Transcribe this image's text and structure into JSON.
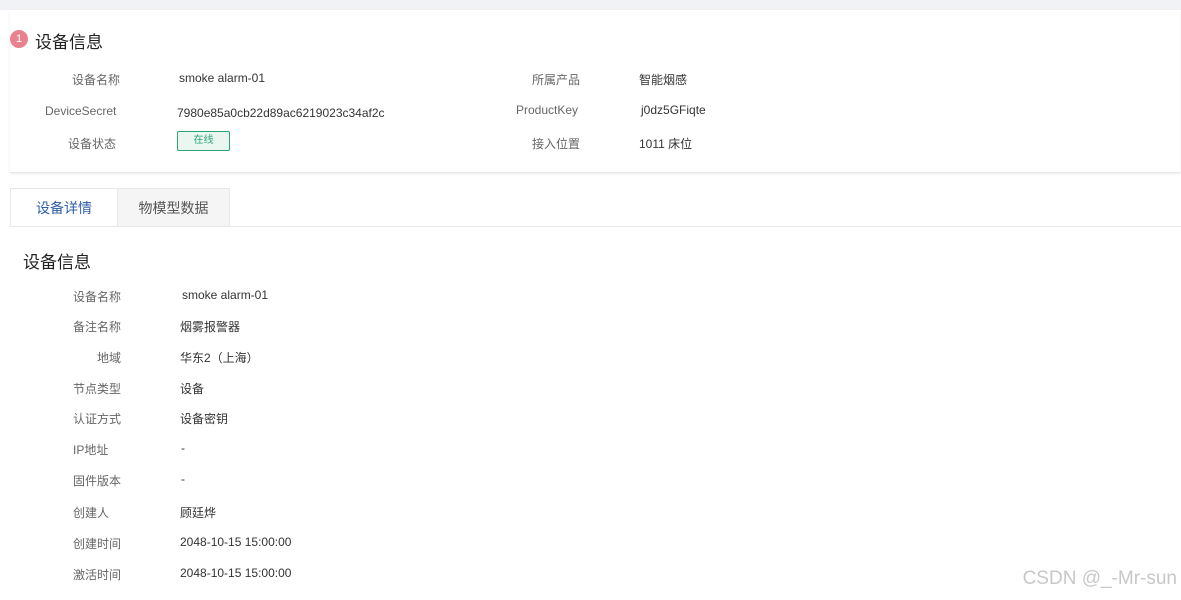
{
  "summary": {
    "badge": "1",
    "title": "设备信息",
    "left": [
      {
        "label": "设备名称",
        "value": "smoke alarm-01"
      },
      {
        "label": "DeviceSecret",
        "value": "7980e85a0cb22d89ac6219023c34af2c"
      },
      {
        "label": "设备状态",
        "value": "在线"
      }
    ],
    "right": [
      {
        "label": "所属产品",
        "value": "智能烟感"
      },
      {
        "label": "ProductKey",
        "value": "j0dz5GFiqte"
      },
      {
        "label": "接入位置",
        "value": "1011 床位"
      }
    ]
  },
  "tabs": [
    {
      "label": "设备详情",
      "active": true
    },
    {
      "label": "物模型数据",
      "active": false
    }
  ],
  "details": {
    "title": "设备信息",
    "rows": [
      {
        "label": "设备名称",
        "value": "smoke alarm-01"
      },
      {
        "label": "备注名称",
        "value": "烟雾报警器"
      },
      {
        "label": "地域",
        "value": "华东2（上海）"
      },
      {
        "label": "节点类型",
        "value": "设备"
      },
      {
        "label": "认证方式",
        "value": "设备密钥"
      },
      {
        "label": "IP地址",
        "value": "-"
      },
      {
        "label": "固件版本",
        "value": "-"
      },
      {
        "label": "创建人",
        "value": "顾廷烨"
      },
      {
        "label": "创建时间",
        "value": "2048-10-15 15:00:00"
      },
      {
        "label": "激活时间",
        "value": "2048-10-15 15:00:00"
      }
    ]
  },
  "watermark": "CSDN @_-Mr-sun",
  "colors": {
    "accent": "#2f5fa8",
    "online": "#2aa37a",
    "badge": "#e8828e"
  }
}
